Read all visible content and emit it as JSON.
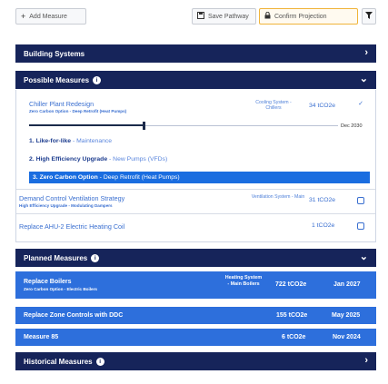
{
  "toolbar": {
    "add_measure": "Add Measure",
    "save_pathway": "Save Pathway",
    "confirm_projection": "Confirm Projection"
  },
  "sections": {
    "building_systems": "Building Systems",
    "possible_measures": "Possible Measures",
    "planned_measures": "Planned Measures",
    "historical_measures": "Historical Measures"
  },
  "possible": {
    "m1": {
      "title": "Chiller Plant Redesign",
      "subtitle": "Zero Carbon Option - Deep Retrofit (Heat Pumps)",
      "category": "Cooling System - Chillers",
      "value": "34 tCO2e",
      "checked": true,
      "slider_date": "Dec 2030",
      "options": [
        {
          "num": "1.",
          "name": "Like-for-like",
          "desc": "Maintenance"
        },
        {
          "num": "2.",
          "name": "High Efficiency Upgrade",
          "desc": "New Pumps (VFDs)"
        },
        {
          "num": "3.",
          "name": "Zero Carbon Option",
          "desc": "Deep Retrofit (Heat Pumps)"
        }
      ]
    },
    "m2": {
      "title": "Demand Control Ventilation Strategy",
      "subtitle": "High Efficiency Upgrade - Modulating Dampers",
      "category": "Ventilation System - Main",
      "value": "31 tCO2e"
    },
    "m3": {
      "title": "Replace AHU-2 Electric Heating Coil",
      "value": "1 tCO2e"
    }
  },
  "planned": [
    {
      "name": "Replace Boilers",
      "sub": "Zero Carbon Option - Electric Boilers",
      "category": "Heating System - Main Boilers",
      "value": "722 tCO2e",
      "date": "Jan 2027"
    },
    {
      "name": "Replace Zone Controls with DDC",
      "value": "155 tCO2e",
      "date": "May 2025"
    },
    {
      "name": "Measure 85",
      "value": "6 tCO2e",
      "date": "Nov 2024"
    }
  ],
  "colors": {
    "navy": "#16245a",
    "blue": "#2d6fdc",
    "selected": "#1a6de0",
    "accent_outline": "#f0b43a"
  },
  "icons": {
    "add": "plus-icon",
    "save": "save-icon",
    "confirm": "lock-icon",
    "filter": "filter-icon",
    "info": "info-icon",
    "collapse": "chevron-down-icon",
    "expand": "chevron-right-icon"
  }
}
